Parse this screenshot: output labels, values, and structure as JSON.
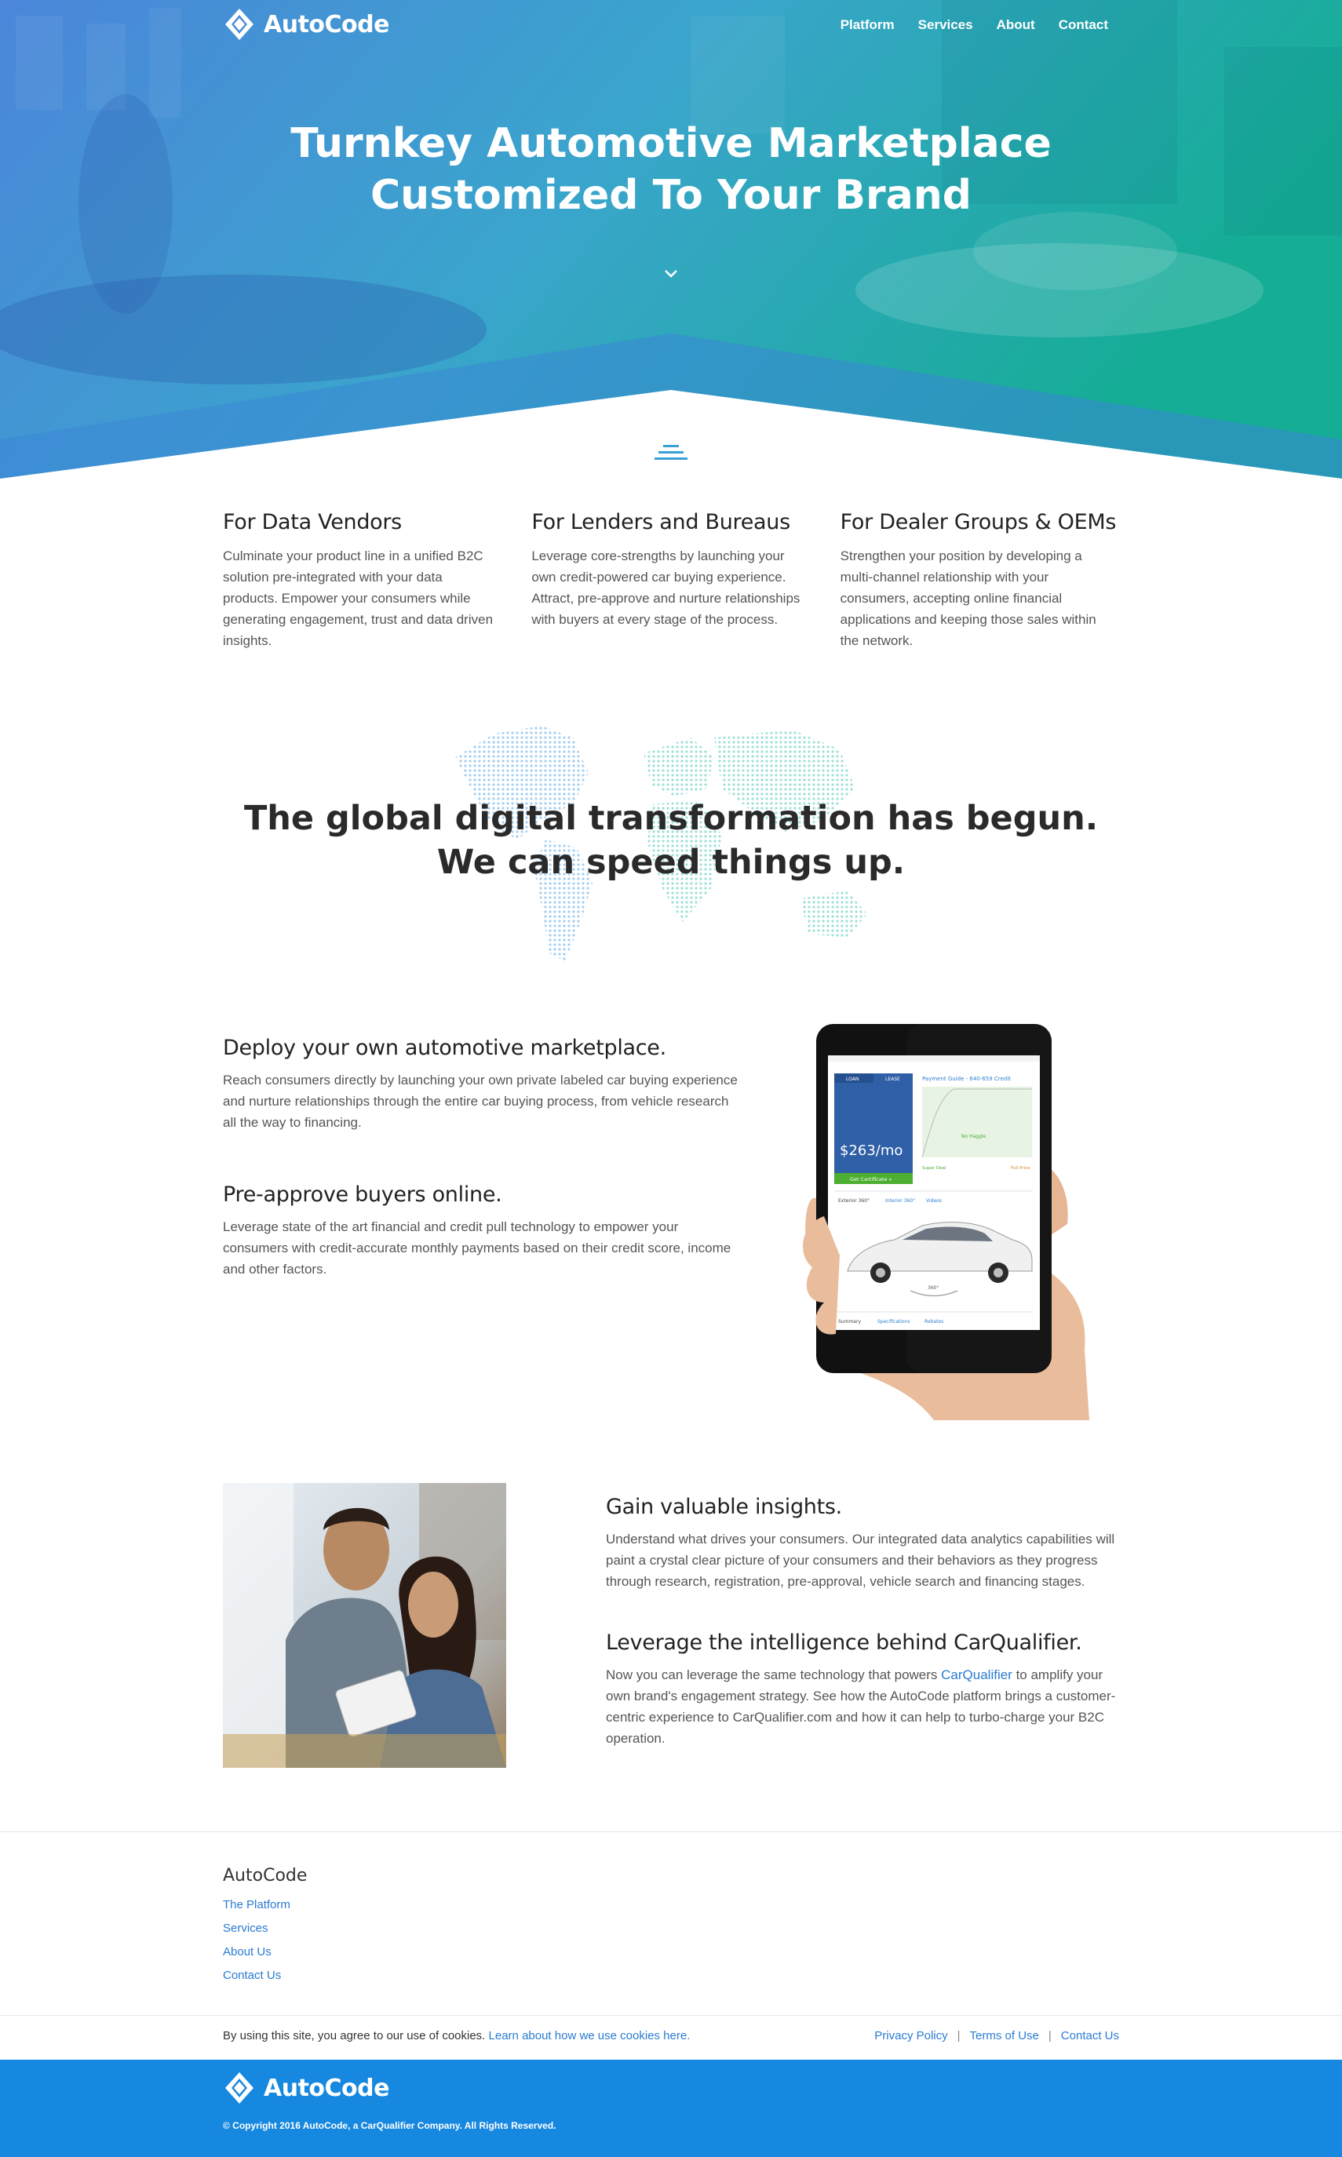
{
  "brand": {
    "name": "AutoCode"
  },
  "nav": {
    "items": [
      "Platform",
      "Services",
      "About",
      "Contact"
    ]
  },
  "hero": {
    "title_line1": "Turnkey Automotive Marketplace",
    "title_line2": "Customized To Your Brand"
  },
  "columns": [
    {
      "title": "For Data Vendors",
      "text": "Culminate your product line in a unified B2C solution pre-integrated with your data products. Empower your consumers while generating engagement, trust and data driven insights."
    },
    {
      "title": "For Lenders and Bureaus",
      "text": "Leverage core-strengths by launching your own credit-powered car buying experience. Attract, pre-approve and nurture relationships with buyers at every stage of the process."
    },
    {
      "title": "For Dealer Groups & OEMs",
      "text": "Strengthen your position by developing a multi-channel relationship with your consumers, accepting online financial applications and keeping those sales within the network."
    }
  ],
  "global": {
    "line1": "The global digital transformation has begun.",
    "line2": "We can speed things up."
  },
  "features": {
    "deploy": {
      "title": "Deploy your own automotive marketplace.",
      "text": "Reach consumers directly by launching your own private labeled car buying experience and nurture relationships through the entire car buying process, from vehicle research all the way to financing."
    },
    "preapprove": {
      "title": "Pre-approve buyers online.",
      "text": "Leverage state of the art financial and credit pull technology to empower your consumers with credit-accurate monthly payments based on their credit score, income and other factors."
    },
    "insights": {
      "title": "Gain valuable insights.",
      "text": "Understand what drives your consumers. Our integrated data analytics capabilities will paint a crystal clear picture of your consumers and their behaviors as they progress through research, registration, pre-approval, vehicle search and financing stages."
    },
    "leverage": {
      "title": "Leverage the intelligence behind CarQualifier.",
      "text_before": "Now you can leverage the same technology that powers ",
      "link": "CarQualifier",
      "text_after": " to amplify your own brand's engagement strategy. See how the AutoCode platform brings a customer-centric experience to CarQualifier.com and how it can help to turbo-charge your B2C operation."
    }
  },
  "tablet": {
    "tab_loan": "LOAN",
    "tab_lease": "LEASE",
    "payment_guide": "Payment Guide - 640-659 Credit",
    "price": "$263/mo",
    "cta": "Get Certificate »",
    "tab_ext": "Exterior 360°",
    "tab_int": "Interior 360°",
    "tab_videos": "Videos",
    "degree": "360°",
    "bottom_summary": "Summary",
    "bottom_specs": "Specifications",
    "bottom_rebates": "Rebates",
    "no_haggle": "No Haggle",
    "super_deal": "Super Deal",
    "full_price": "Full Price"
  },
  "footer": {
    "brand": "AutoCode",
    "links": [
      "The Platform",
      "Services",
      "About Us",
      "Contact Us"
    ],
    "cookie_text": "By using this site, you agree to our use of cookies. ",
    "cookie_link": "Learn about how we use cookies here.",
    "legal": [
      "Privacy Policy",
      "Terms of Use",
      "Contact Us"
    ],
    "separator": "|",
    "copyright": "© Copyright 2016 AutoCode, a CarQualifier Company. All Rights Reserved."
  },
  "colors": {
    "accent": "#1688df",
    "link": "#2a7bd1",
    "hero_start": "#4a84d8",
    "hero_end": "#18ae98"
  }
}
